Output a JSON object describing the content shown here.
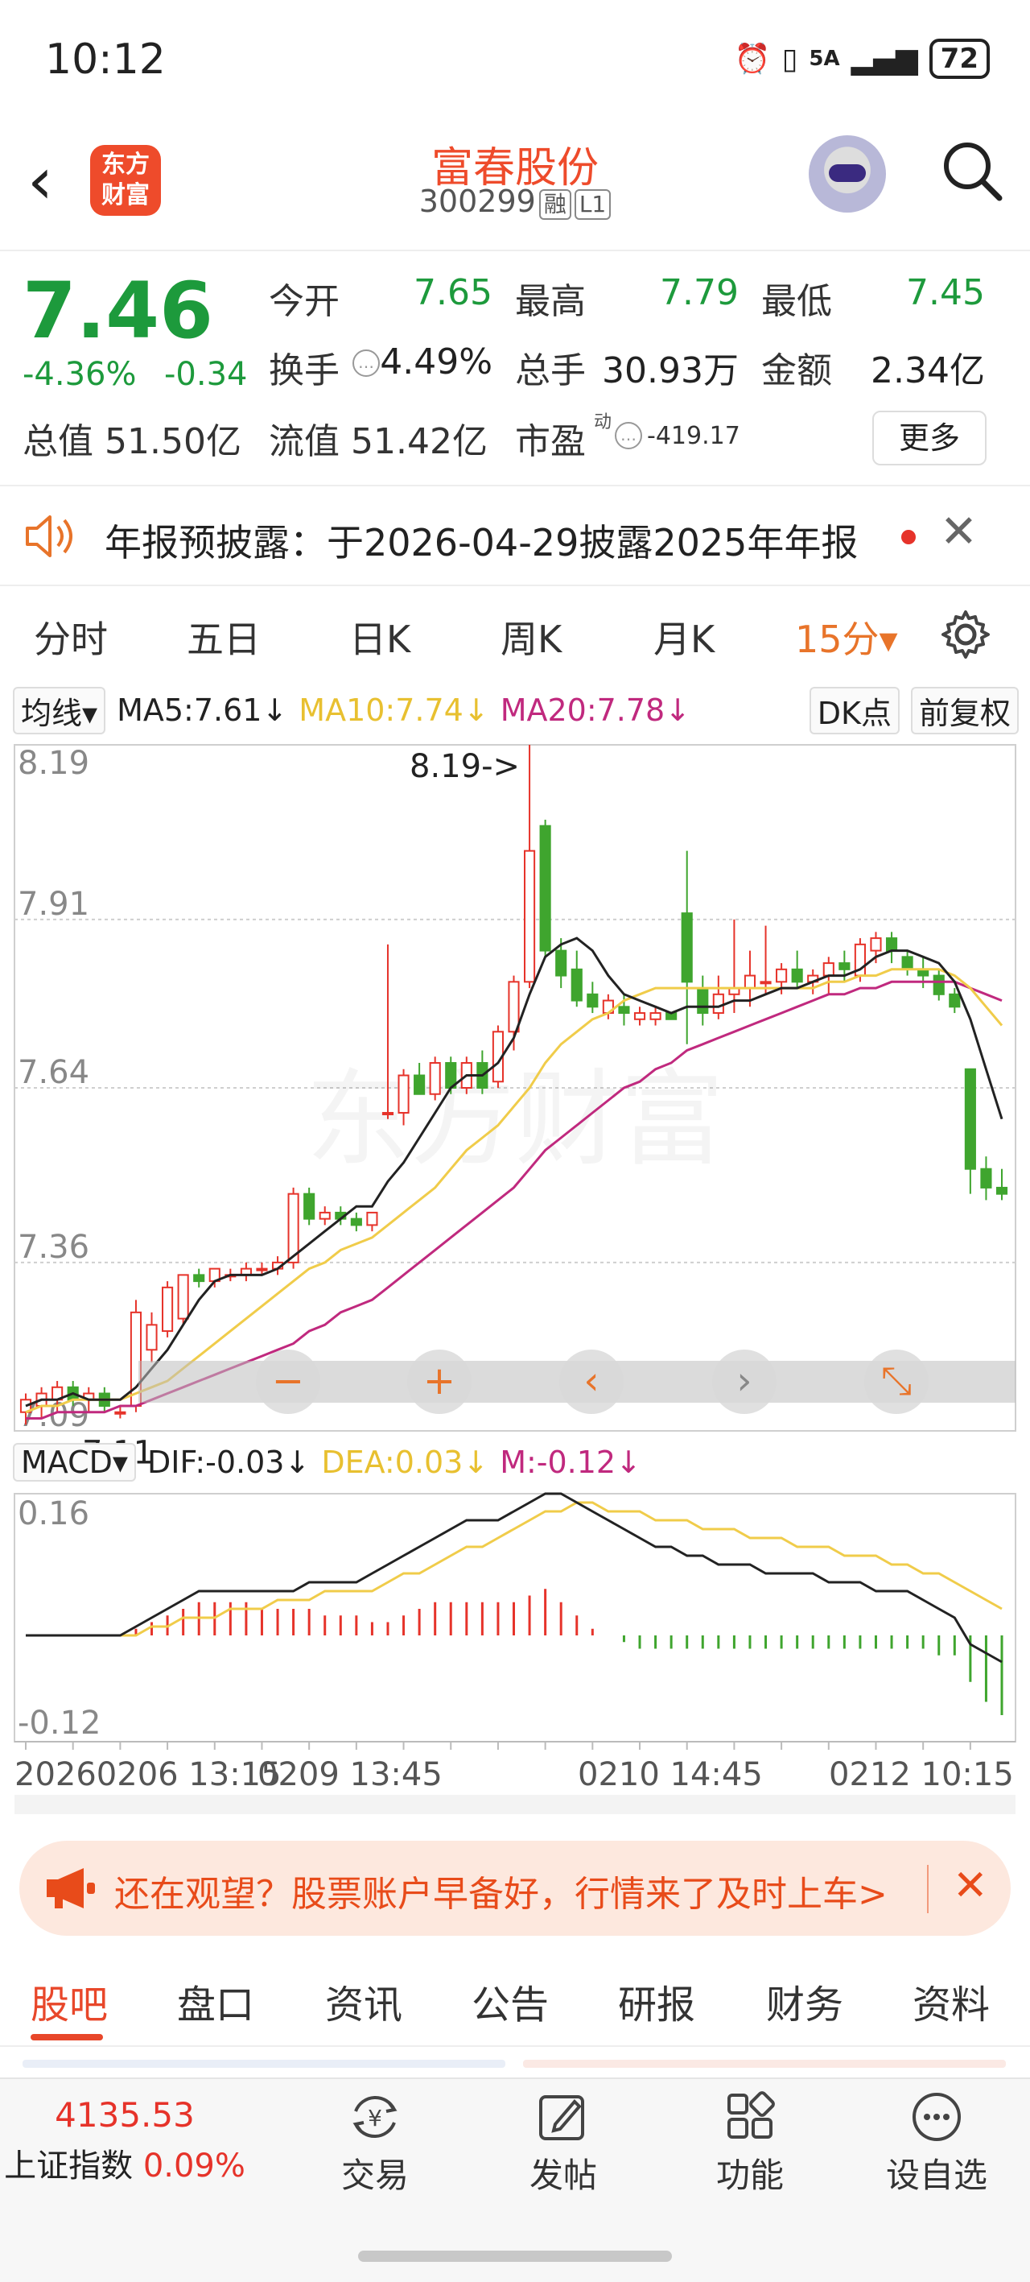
{
  "status_bar": {
    "time": "10:12",
    "network": "5A",
    "battery": "72"
  },
  "header": {
    "logo_line1": "东方",
    "logo_line2": "财富",
    "stock_name": "富春股份",
    "stock_code": "300299",
    "tag_margin": "融",
    "tag_level": "L1"
  },
  "quote": {
    "price": "7.46",
    "change_pct": "-4.36%",
    "change_amt": "-0.34",
    "open_label": "今开",
    "open": "7.65",
    "high_label": "最高",
    "high": "7.79",
    "low_label": "最低",
    "low": "7.45",
    "turnover_label": "换手",
    "turnover": "4.49%",
    "volume_label": "总手",
    "volume": "30.93万",
    "amount_label": "金额",
    "amount": "2.34亿",
    "mktcap": "总值 51.50亿",
    "float_cap": "流值 51.42亿",
    "pe_label": "市盈",
    "pe_sup": "动",
    "pe": "-419.17",
    "more_label": "更多"
  },
  "notice": {
    "text": "年报预披露：于2026-04-29披露2025年年报"
  },
  "kline_tabs": [
    "分时",
    "五日",
    "日K",
    "周K",
    "月K",
    "15分▾"
  ],
  "ma_bar": {
    "selector": "均线▾",
    "ma5": "MA5:7.61↓",
    "ma10": "MA10:7.74↓",
    "ma20": "MA20:7.78↓",
    "dk": "DK点",
    "adjust": "前复权"
  },
  "macd_bar": {
    "selector": "MACD▾",
    "dif": "DIF:-0.03↓",
    "dea": "DEA:0.03↓",
    "m": "M:-0.12↓"
  },
  "colors": {
    "up": "#e6332a",
    "down": "#3fa52e",
    "ma5": "#222222",
    "ma10": "#f0cc4a",
    "ma20": "#c0297e",
    "accent": "#e8742a"
  },
  "chart_data": {
    "type": "candlestick",
    "interval": "15分",
    "y_ticks": [
      "8.19",
      "7.91",
      "7.64",
      "7.36",
      "7.09"
    ],
    "ylim": [
      7.09,
      8.19
    ],
    "x_ticks": [
      "20260206 13:15",
      "0209 13:45",
      "0210 14:45",
      "0212 10:15"
    ],
    "max_annotation": "8.19->",
    "min_annotation": "<-7.11",
    "candles": [
      {
        "o": 7.12,
        "h": 7.15,
        "l": 7.1,
        "c": 7.14
      },
      {
        "o": 7.13,
        "h": 7.16,
        "l": 7.11,
        "c": 7.15
      },
      {
        "o": 7.14,
        "h": 7.17,
        "l": 7.12,
        "c": 7.16
      },
      {
        "o": 7.16,
        "h": 7.17,
        "l": 7.13,
        "c": 7.14
      },
      {
        "o": 7.14,
        "h": 7.16,
        "l": 7.12,
        "c": 7.15
      },
      {
        "o": 7.15,
        "h": 7.16,
        "l": 7.12,
        "c": 7.13
      },
      {
        "o": 7.12,
        "h": 7.13,
        "l": 7.11,
        "c": 7.12
      },
      {
        "o": 7.13,
        "h": 7.3,
        "l": 7.12,
        "c": 7.28
      },
      {
        "o": 7.22,
        "h": 7.28,
        "l": 7.2,
        "c": 7.26
      },
      {
        "o": 7.25,
        "h": 7.33,
        "l": 7.24,
        "c": 7.32
      },
      {
        "o": 7.27,
        "h": 7.34,
        "l": 7.26,
        "c": 7.34
      },
      {
        "o": 7.34,
        "h": 7.35,
        "l": 7.32,
        "c": 7.33
      },
      {
        "o": 7.33,
        "h": 7.35,
        "l": 7.32,
        "c": 7.35
      },
      {
        "o": 7.34,
        "h": 7.35,
        "l": 7.33,
        "c": 7.34
      },
      {
        "o": 7.34,
        "h": 7.36,
        "l": 7.33,
        "c": 7.35
      },
      {
        "o": 7.35,
        "h": 7.36,
        "l": 7.34,
        "c": 7.35
      },
      {
        "o": 7.35,
        "h": 7.37,
        "l": 7.34,
        "c": 7.36
      },
      {
        "o": 7.36,
        "h": 7.48,
        "l": 7.35,
        "c": 7.47
      },
      {
        "o": 7.47,
        "h": 7.48,
        "l": 7.42,
        "c": 7.43
      },
      {
        "o": 7.43,
        "h": 7.45,
        "l": 7.42,
        "c": 7.44
      },
      {
        "o": 7.44,
        "h": 7.45,
        "l": 7.42,
        "c": 7.43
      },
      {
        "o": 7.43,
        "h": 7.44,
        "l": 7.41,
        "c": 7.42
      },
      {
        "o": 7.42,
        "h": 7.44,
        "l": 7.41,
        "c": 7.44
      },
      {
        "o": 7.6,
        "h": 7.87,
        "l": 7.59,
        "c": 7.6
      },
      {
        "o": 7.6,
        "h": 7.67,
        "l": 7.58,
        "c": 7.66
      },
      {
        "o": 7.66,
        "h": 7.68,
        "l": 7.63,
        "c": 7.63
      },
      {
        "o": 7.63,
        "h": 7.69,
        "l": 7.62,
        "c": 7.68
      },
      {
        "o": 7.68,
        "h": 7.69,
        "l": 7.63,
        "c": 7.64
      },
      {
        "o": 7.64,
        "h": 7.69,
        "l": 7.63,
        "c": 7.68
      },
      {
        "o": 7.68,
        "h": 7.7,
        "l": 7.63,
        "c": 7.64
      },
      {
        "o": 7.65,
        "h": 7.74,
        "l": 7.64,
        "c": 7.73
      },
      {
        "o": 7.73,
        "h": 7.82,
        "l": 7.7,
        "c": 7.81
      },
      {
        "o": 7.81,
        "h": 8.19,
        "l": 7.8,
        "c": 8.02
      },
      {
        "o": 8.06,
        "h": 8.07,
        "l": 7.85,
        "c": 7.86
      },
      {
        "o": 7.86,
        "h": 7.88,
        "l": 7.8,
        "c": 7.82
      },
      {
        "o": 7.83,
        "h": 7.86,
        "l": 7.77,
        "c": 7.78
      },
      {
        "o": 7.79,
        "h": 7.81,
        "l": 7.76,
        "c": 7.77
      },
      {
        "o": 7.76,
        "h": 7.79,
        "l": 7.75,
        "c": 7.78
      },
      {
        "o": 7.77,
        "h": 7.79,
        "l": 7.74,
        "c": 7.76
      },
      {
        "o": 7.75,
        "h": 7.77,
        "l": 7.74,
        "c": 7.76
      },
      {
        "o": 7.75,
        "h": 7.77,
        "l": 7.74,
        "c": 7.76
      },
      {
        "o": 7.76,
        "h": 7.76,
        "l": 7.75,
        "c": 7.75
      },
      {
        "o": 7.92,
        "h": 8.02,
        "l": 7.71,
        "c": 7.81
      },
      {
        "o": 7.8,
        "h": 7.82,
        "l": 7.74,
        "c": 7.76
      },
      {
        "o": 7.76,
        "h": 7.82,
        "l": 7.75,
        "c": 7.79
      },
      {
        "o": 7.79,
        "h": 7.91,
        "l": 7.76,
        "c": 7.8
      },
      {
        "o": 7.8,
        "h": 7.86,
        "l": 7.77,
        "c": 7.82
      },
      {
        "o": 7.81,
        "h": 7.9,
        "l": 7.79,
        "c": 7.81
      },
      {
        "o": 7.81,
        "h": 7.84,
        "l": 7.79,
        "c": 7.83
      },
      {
        "o": 7.83,
        "h": 7.86,
        "l": 7.8,
        "c": 7.81
      },
      {
        "o": 7.81,
        "h": 7.83,
        "l": 7.79,
        "c": 7.82
      },
      {
        "o": 7.82,
        "h": 7.85,
        "l": 7.79,
        "c": 7.84
      },
      {
        "o": 7.84,
        "h": 7.86,
        "l": 7.81,
        "c": 7.83
      },
      {
        "o": 7.82,
        "h": 7.88,
        "l": 7.81,
        "c": 7.87
      },
      {
        "o": 7.86,
        "h": 7.89,
        "l": 7.84,
        "c": 7.88
      },
      {
        "o": 7.88,
        "h": 7.89,
        "l": 7.84,
        "c": 7.86
      },
      {
        "o": 7.85,
        "h": 7.86,
        "l": 7.82,
        "c": 7.83
      },
      {
        "o": 7.83,
        "h": 7.85,
        "l": 7.8,
        "c": 7.82
      },
      {
        "o": 7.82,
        "h": 7.83,
        "l": 7.78,
        "c": 7.79
      },
      {
        "o": 7.79,
        "h": 7.8,
        "l": 7.76,
        "c": 7.77
      },
      {
        "o": 7.67,
        "h": 7.67,
        "l": 7.47,
        "c": 7.51
      },
      {
        "o": 7.51,
        "h": 7.53,
        "l": 7.46,
        "c": 7.48
      },
      {
        "o": 7.48,
        "h": 7.51,
        "l": 7.46,
        "c": 7.47
      }
    ],
    "ma_lines": {
      "ma5": [
        7.13,
        7.14,
        7.14,
        7.15,
        7.14,
        7.14,
        7.14,
        7.16,
        7.19,
        7.22,
        7.26,
        7.3,
        7.33,
        7.34,
        7.34,
        7.34,
        7.35,
        7.37,
        7.39,
        7.41,
        7.43,
        7.45,
        7.45,
        7.49,
        7.52,
        7.56,
        7.6,
        7.64,
        7.66,
        7.66,
        7.68,
        7.72,
        7.79,
        7.85,
        7.87,
        7.88,
        7.86,
        7.82,
        7.79,
        7.78,
        7.77,
        7.76,
        7.77,
        7.77,
        7.77,
        7.78,
        7.78,
        7.79,
        7.8,
        7.8,
        7.81,
        7.82,
        7.82,
        7.83,
        7.85,
        7.86,
        7.86,
        7.85,
        7.84,
        7.81,
        7.75,
        7.67,
        7.59
      ],
      "ma10": [
        7.12,
        7.13,
        7.13,
        7.14,
        7.14,
        7.14,
        7.14,
        7.15,
        7.16,
        7.17,
        7.19,
        7.21,
        7.23,
        7.25,
        7.27,
        7.29,
        7.31,
        7.33,
        7.35,
        7.36,
        7.38,
        7.39,
        7.4,
        7.42,
        7.44,
        7.46,
        7.48,
        7.51,
        7.54,
        7.56,
        7.58,
        7.61,
        7.64,
        7.68,
        7.71,
        7.73,
        7.75,
        7.76,
        7.78,
        7.79,
        7.8,
        7.8,
        7.8,
        7.8,
        7.8,
        7.8,
        7.8,
        7.8,
        7.8,
        7.8,
        7.8,
        7.81,
        7.81,
        7.82,
        7.82,
        7.83,
        7.83,
        7.83,
        7.83,
        7.82,
        7.8,
        7.77,
        7.74
      ],
      "ma20": [
        7.11,
        7.11,
        7.12,
        7.12,
        7.12,
        7.12,
        7.13,
        7.13,
        7.14,
        7.15,
        7.16,
        7.17,
        7.18,
        7.19,
        7.2,
        7.21,
        7.22,
        7.23,
        7.25,
        7.26,
        7.28,
        7.29,
        7.3,
        7.32,
        7.34,
        7.36,
        7.38,
        7.4,
        7.42,
        7.44,
        7.46,
        7.48,
        7.51,
        7.54,
        7.56,
        7.58,
        7.6,
        7.62,
        7.64,
        7.65,
        7.67,
        7.68,
        7.7,
        7.71,
        7.72,
        7.73,
        7.74,
        7.75,
        7.76,
        7.77,
        7.78,
        7.79,
        7.79,
        7.8,
        7.8,
        7.81,
        7.81,
        7.81,
        7.81,
        7.81,
        7.8,
        7.79,
        7.78
      ]
    },
    "macd": {
      "y_ticks": [
        "0.16",
        "-0.12"
      ],
      "ylim": [
        -0.12,
        0.16
      ],
      "bars": [
        0.0,
        0.0,
        0.0,
        0.0,
        0.0,
        0.0,
        0.0,
        0.01,
        0.02,
        0.03,
        0.04,
        0.05,
        0.05,
        0.05,
        0.05,
        0.04,
        0.04,
        0.04,
        0.04,
        0.03,
        0.03,
        0.03,
        0.02,
        0.02,
        0.03,
        0.04,
        0.05,
        0.05,
        0.05,
        0.05,
        0.05,
        0.05,
        0.06,
        0.07,
        0.05,
        0.03,
        0.01,
        0.0,
        -0.01,
        -0.02,
        -0.02,
        -0.02,
        -0.02,
        -0.02,
        -0.02,
        -0.02,
        -0.02,
        -0.02,
        -0.02,
        -0.02,
        -0.02,
        -0.02,
        -0.02,
        -0.02,
        -0.02,
        -0.02,
        -0.02,
        -0.02,
        -0.03,
        -0.03,
        -0.07,
        -0.1,
        -0.12
      ],
      "dif": [
        0.0,
        0.0,
        0.0,
        0.0,
        0.0,
        0.0,
        0.0,
        0.01,
        0.02,
        0.03,
        0.04,
        0.05,
        0.05,
        0.05,
        0.05,
        0.05,
        0.05,
        0.05,
        0.06,
        0.06,
        0.06,
        0.06,
        0.07,
        0.08,
        0.09,
        0.1,
        0.11,
        0.12,
        0.13,
        0.13,
        0.13,
        0.14,
        0.15,
        0.16,
        0.16,
        0.15,
        0.14,
        0.13,
        0.12,
        0.11,
        0.1,
        0.1,
        0.09,
        0.09,
        0.08,
        0.08,
        0.08,
        0.07,
        0.07,
        0.07,
        0.07,
        0.06,
        0.06,
        0.06,
        0.05,
        0.05,
        0.05,
        0.04,
        0.03,
        0.02,
        -0.01,
        -0.02,
        -0.03
      ],
      "dea": [
        0.0,
        0.0,
        0.0,
        0.0,
        0.0,
        0.0,
        0.0,
        0.0,
        0.01,
        0.01,
        0.02,
        0.02,
        0.02,
        0.03,
        0.03,
        0.03,
        0.04,
        0.04,
        0.04,
        0.05,
        0.05,
        0.05,
        0.05,
        0.06,
        0.07,
        0.07,
        0.08,
        0.09,
        0.1,
        0.1,
        0.11,
        0.12,
        0.13,
        0.14,
        0.14,
        0.15,
        0.15,
        0.14,
        0.14,
        0.14,
        0.13,
        0.13,
        0.13,
        0.12,
        0.12,
        0.12,
        0.11,
        0.11,
        0.11,
        0.1,
        0.1,
        0.1,
        0.09,
        0.09,
        0.09,
        0.08,
        0.08,
        0.07,
        0.07,
        0.06,
        0.05,
        0.04,
        0.03
      ]
    }
  },
  "toolbar_icons": [
    "minus-icon",
    "plus-icon",
    "chevron-left-icon",
    "chevron-right-icon",
    "expand-icon"
  ],
  "ad": {
    "text": "还在观望？股票账户早备好，行情来了及时上车>"
  },
  "bottom_tabs": [
    "股吧",
    "盘口",
    "资讯",
    "公告",
    "研报",
    "财务",
    "资料"
  ],
  "bottom_bar": {
    "index_value": "4135.53",
    "index_name": "上证指数",
    "index_change": "0.09%",
    "buttons": [
      {
        "label": "交易",
        "icon": "yen-cycle-icon"
      },
      {
        "label": "发帖",
        "icon": "edit-icon"
      },
      {
        "label": "功能",
        "icon": "grid-icon"
      },
      {
        "label": "设自选",
        "icon": "more-dots-icon"
      }
    ]
  }
}
